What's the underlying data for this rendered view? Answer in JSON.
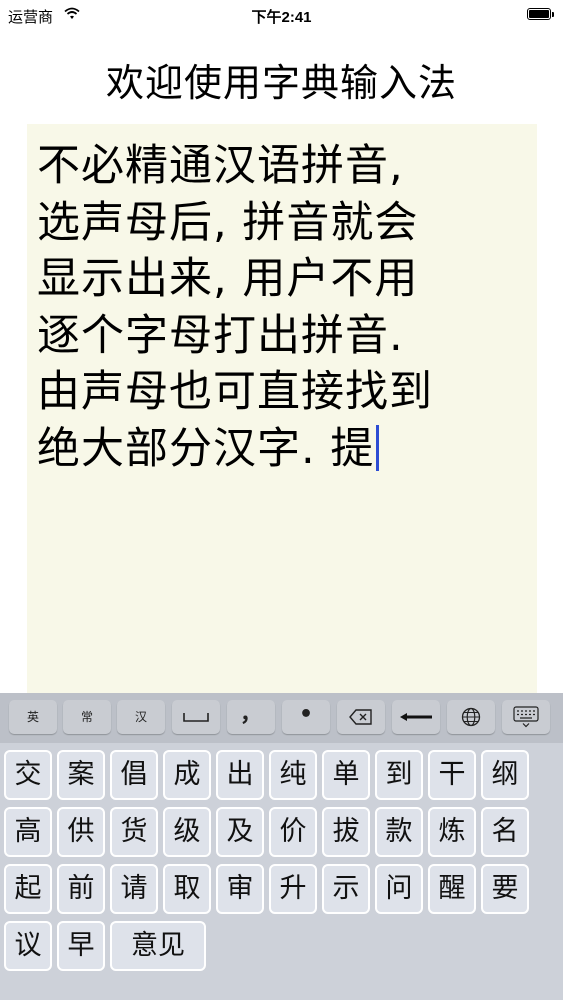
{
  "status_bar": {
    "carrier": "运营商",
    "time": "下午2:41",
    "wifi_icon": "wifi-icon",
    "battery_icon": "battery-full-icon"
  },
  "title": "欢迎使用字典输入法",
  "text_area": {
    "lines": [
      "不必精通汉语拼音,",
      "选声母后, 拼音就会",
      "显示出来, 用户不用",
      "逐个字母打出拼音.",
      "由声母也可直接找到",
      "绝大部分汉字. 提"
    ],
    "background": "#f8f8e8",
    "caret_color": "#2d4dd3"
  },
  "keyboard": {
    "toolbar": [
      {
        "label": "英",
        "icon": null
      },
      {
        "label": "常",
        "icon": null
      },
      {
        "label": "汉",
        "icon": null
      },
      {
        "label": "␣",
        "icon": "space-icon"
      },
      {
        "label": "，",
        "icon": null
      },
      {
        "label": "•",
        "icon": null
      },
      {
        "label": "",
        "icon": "delete-icon"
      },
      {
        "label": "",
        "icon": "return-icon"
      },
      {
        "label": "",
        "icon": "globe-icon"
      },
      {
        "label": "",
        "icon": "keyboard-hide-icon"
      }
    ],
    "candidate_rows": [
      [
        "交",
        "案",
        "倡",
        "成",
        "出",
        "纯",
        "单",
        "到",
        "干",
        "纲"
      ],
      [
        "高",
        "供",
        "货",
        "级",
        "及",
        "价",
        "拔",
        "款",
        "炼",
        "名"
      ],
      [
        "起",
        "前",
        "请",
        "取",
        "审",
        "升",
        "示",
        "问",
        "醒",
        "要"
      ],
      [
        "议",
        "早",
        "意见"
      ]
    ]
  }
}
